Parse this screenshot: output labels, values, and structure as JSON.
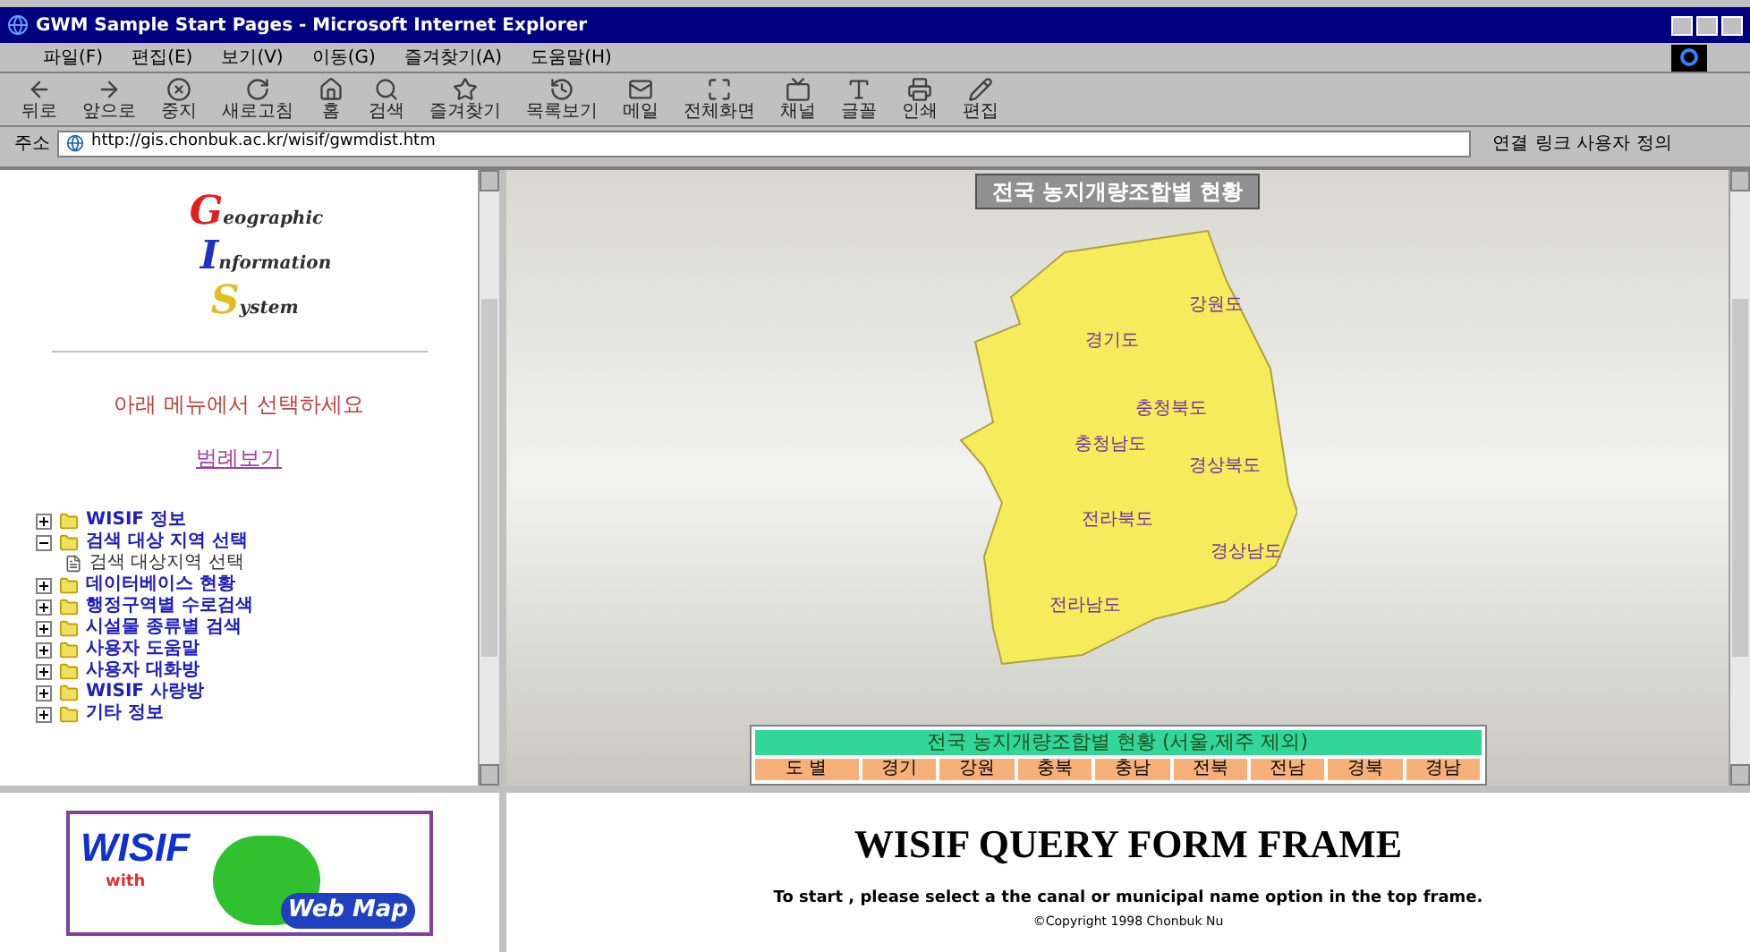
{
  "window": {
    "title": "GWM Sample Start Pages - Microsoft Internet Explorer"
  },
  "menu": [
    "파일(F)",
    "편집(E)",
    "보기(V)",
    "이동(G)",
    "즐겨찾기(A)",
    "도움말(H)"
  ],
  "toolbar": [
    {
      "kind": "back",
      "label": "뒤로"
    },
    {
      "kind": "forward",
      "label": "앞으로"
    },
    {
      "kind": "stop",
      "label": "중지"
    },
    {
      "kind": "refresh",
      "label": "새로고침"
    },
    {
      "kind": "home",
      "label": "홈"
    },
    {
      "kind": "search",
      "label": "검색"
    },
    {
      "kind": "favorites",
      "label": "즐겨찾기"
    },
    {
      "kind": "history",
      "label": "목록보기"
    },
    {
      "kind": "mail",
      "label": "메일"
    },
    {
      "kind": "fullscreen",
      "label": "전체화면"
    },
    {
      "kind": "channels",
      "label": "채널"
    },
    {
      "kind": "font",
      "label": "글꼴"
    },
    {
      "kind": "print",
      "label": "인쇄"
    },
    {
      "kind": "edit",
      "label": "편집"
    }
  ],
  "address_bar": {
    "label": "주소",
    "value": "http://gis.chonbuk.ac.kr/wisif/gwmdist.htm",
    "links_label": "연결",
    "link": "링크 사용자 정의"
  },
  "left_frame": {
    "logo_words": [
      "Geographic",
      "Information",
      "System"
    ],
    "prompt": "아래 메뉴에서 선택하세요",
    "legend_link": "범례보기",
    "tree": [
      {
        "label": "WISIF 정보",
        "expanded": false
      },
      {
        "label": "검색 대상 지역 선택",
        "expanded": true,
        "children": [
          {
            "label": "검색 대상지역 선택"
          }
        ]
      },
      {
        "label": "데이터베이스 현황",
        "expanded": false
      },
      {
        "label": "행정구역별 수로검색",
        "expanded": false
      },
      {
        "label": "시설물 종류별 검색",
        "expanded": false
      },
      {
        "label": "사용자 도움말",
        "expanded": false
      },
      {
        "label": "사용자 대화방",
        "expanded": false
      },
      {
        "label": "WISIF 사랑방",
        "expanded": false
      },
      {
        "label": "기타 정보",
        "expanded": false
      }
    ]
  },
  "map_frame": {
    "title": "전국 농지개량조합별 현황",
    "provinces": [
      "강원도",
      "경기도",
      "충청북도",
      "충청남도",
      "경상북도",
      "전라북도",
      "경상남도",
      "전라남도"
    ],
    "table_title": "전국 농지개량조합별 현황 (서울,제주 제외)",
    "table_cells": [
      "도 별",
      "경기",
      "강원",
      "충북",
      "충남",
      "전북",
      "전남",
      "경북",
      "경남"
    ]
  },
  "bottom_left": {
    "logo_words": [
      "WISIF",
      "with",
      "Web Map"
    ]
  },
  "bottom_right": {
    "heading": "WISIF QUERY FORM FRAME",
    "instruction": "To start , please select a the canal or municipal name option in the top frame.",
    "copyright": "©Copyright 1998 Chonbuk Nu"
  }
}
